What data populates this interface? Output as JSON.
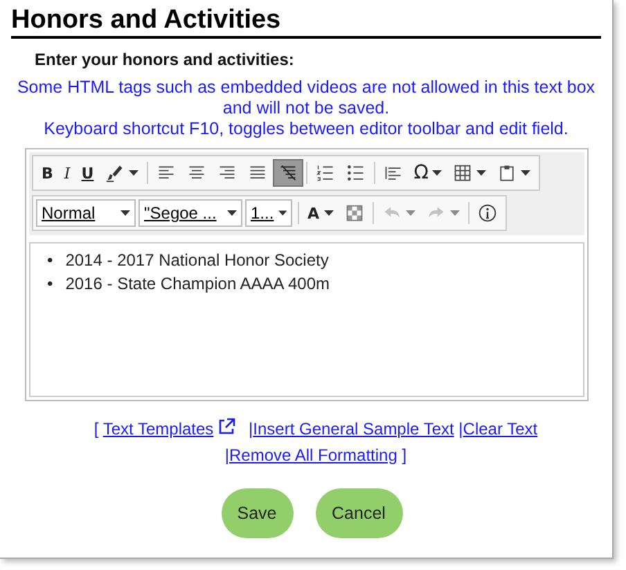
{
  "title": "Honors and Activities",
  "prompt": "Enter your honors and activities:",
  "notice": [
    "Some HTML tags such as embedded videos are not allowed in this text box and will not be saved.",
    "Keyboard shortcut F10, toggles between editor toolbar and edit field."
  ],
  "toolbar": [
    [
      {
        "kind": "bold",
        "label": "B",
        "pressed": false,
        "disabled": false,
        "dropdown": false
      },
      {
        "kind": "italic",
        "label": "I",
        "pressed": false,
        "disabled": false,
        "dropdown": false
      },
      {
        "kind": "underline",
        "label": "U",
        "pressed": false,
        "disabled": false,
        "dropdown": false
      },
      {
        "kind": "brush",
        "pressed": false,
        "disabled": false,
        "dropdown": true
      },
      {
        "kind": "separator"
      },
      {
        "kind": "align-left",
        "pressed": false,
        "disabled": false,
        "dropdown": false
      },
      {
        "kind": "align-center",
        "pressed": false,
        "disabled": false,
        "dropdown": false
      },
      {
        "kind": "align-right",
        "pressed": false,
        "disabled": false,
        "dropdown": false
      },
      {
        "kind": "justify",
        "pressed": false,
        "disabled": false,
        "dropdown": false
      },
      {
        "kind": "clear-format",
        "pressed": true,
        "disabled": false,
        "dropdown": false
      },
      {
        "kind": "separator"
      },
      {
        "kind": "numbered-list",
        "pressed": false,
        "disabled": false,
        "dropdown": false
      },
      {
        "kind": "bullet-list",
        "pressed": false,
        "disabled": false,
        "dropdown": false
      },
      {
        "kind": "separator"
      },
      {
        "kind": "paragraph",
        "pressed": false,
        "disabled": false,
        "dropdown": false
      },
      {
        "kind": "symbol",
        "label": "Ω",
        "pressed": false,
        "disabled": false,
        "dropdown": true
      },
      {
        "kind": "table",
        "pressed": false,
        "disabled": false,
        "dropdown": true
      },
      {
        "kind": "clipboard",
        "pressed": false,
        "disabled": false,
        "dropdown": true
      }
    ],
    [
      {
        "kind": "combo",
        "label": "Normal"
      },
      {
        "kind": "combo",
        "label": "\"Segoe ..."
      },
      {
        "kind": "combo",
        "label": "1..."
      },
      {
        "kind": "separator"
      },
      {
        "kind": "font-color",
        "label": "A",
        "pressed": false,
        "disabled": false,
        "dropdown": true
      },
      {
        "kind": "grid",
        "pressed": false,
        "disabled": false,
        "dropdown": false
      },
      {
        "kind": "separator"
      },
      {
        "kind": "undo",
        "pressed": false,
        "disabled": true,
        "dropdown": true
      },
      {
        "kind": "redo",
        "pressed": false,
        "disabled": true,
        "dropdown": true
      },
      {
        "kind": "separator"
      },
      {
        "kind": "info",
        "pressed": false,
        "disabled": false,
        "dropdown": false
      }
    ]
  ],
  "content": [
    {
      "bullet": "•",
      "text": "2014 - 2017 National Honor Society"
    },
    {
      "bullet": "•",
      "text": "2016 - State Champion AAAA 400m"
    }
  ],
  "links": [
    {
      "kind": "external",
      "label": "Text Templates"
    },
    {
      "kind": "plain",
      "separator": "|",
      "label": "Insert General Sample Text"
    },
    {
      "kind": "plain",
      "separator": "|",
      "label": "Clear Text"
    },
    {
      "kind": "plain",
      "separator": "|",
      "label": "Remove All Formatting"
    }
  ],
  "link_brackets": [
    "[",
    "]"
  ],
  "buttons": [
    "Save",
    "Cancel"
  ]
}
